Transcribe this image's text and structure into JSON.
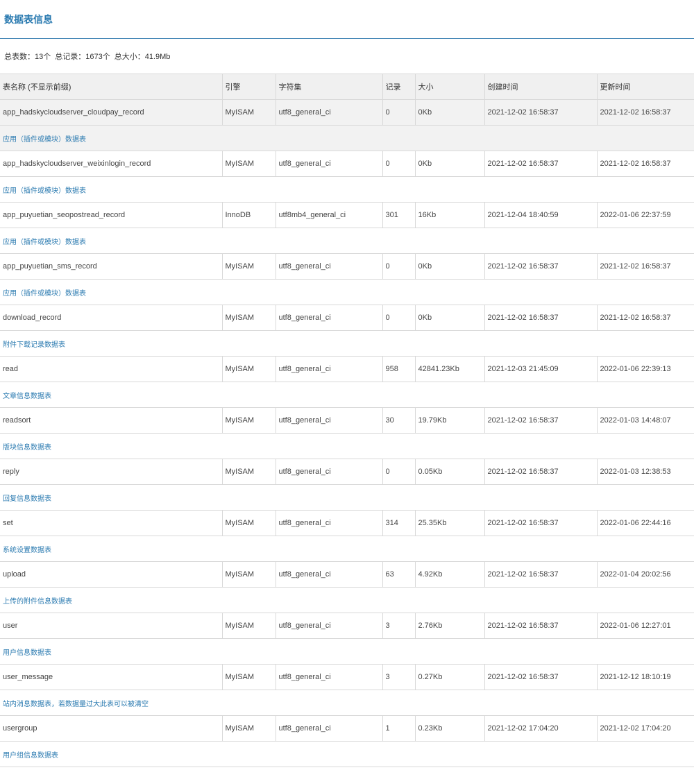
{
  "header": {
    "title": "数据表信息"
  },
  "summary": {
    "tables": "总表数：13个",
    "records": "总记录：1673个",
    "size": "总大小：41.9Mb"
  },
  "table": {
    "columns": [
      "表名称 (不显示前缀)",
      "引擎",
      "字符集",
      "记录",
      "大小",
      "创建时间",
      "更新时间"
    ],
    "rows": [
      {
        "name": "app_hadskycloudserver_cloudpay_record",
        "engine": "MyISAM",
        "charset": "utf8_general_ci",
        "records": "0",
        "size": "0Kb",
        "created": "2021-12-02 16:58:37",
        "updated": "2021-12-02 16:58:37",
        "desc": "应用（插件或模块）数据表"
      },
      {
        "name": "app_hadskycloudserver_weixinlogin_record",
        "engine": "MyISAM",
        "charset": "utf8_general_ci",
        "records": "0",
        "size": "0Kb",
        "created": "2021-12-02 16:58:37",
        "updated": "2021-12-02 16:58:37",
        "desc": "应用（插件或模块）数据表"
      },
      {
        "name": "app_puyuetian_seopostread_record",
        "engine": "InnoDB",
        "charset": "utf8mb4_general_ci",
        "records": "301",
        "size": "16Kb",
        "created": "2021-12-04 18:40:59",
        "updated": "2022-01-06 22:37:59",
        "desc": "应用（插件或模块）数据表"
      },
      {
        "name": "app_puyuetian_sms_record",
        "engine": "MyISAM",
        "charset": "utf8_general_ci",
        "records": "0",
        "size": "0Kb",
        "created": "2021-12-02 16:58:37",
        "updated": "2021-12-02 16:58:37",
        "desc": "应用（插件或模块）数据表"
      },
      {
        "name": "download_record",
        "engine": "MyISAM",
        "charset": "utf8_general_ci",
        "records": "0",
        "size": "0Kb",
        "created": "2021-12-02 16:58:37",
        "updated": "2021-12-02 16:58:37",
        "desc": "附件下载记录数据表"
      },
      {
        "name": "read",
        "engine": "MyISAM",
        "charset": "utf8_general_ci",
        "records": "958",
        "size": "42841.23Kb",
        "created": "2021-12-03 21:45:09",
        "updated": "2022-01-06 22:39:13",
        "desc": "文章信息数据表"
      },
      {
        "name": "readsort",
        "engine": "MyISAM",
        "charset": "utf8_general_ci",
        "records": "30",
        "size": "19.79Kb",
        "created": "2021-12-02 16:58:37",
        "updated": "2022-01-03 14:48:07",
        "desc": "版块信息数据表"
      },
      {
        "name": "reply",
        "engine": "MyISAM",
        "charset": "utf8_general_ci",
        "records": "0",
        "size": "0.05Kb",
        "created": "2021-12-02 16:58:37",
        "updated": "2022-01-03 12:38:53",
        "desc": "回复信息数据表"
      },
      {
        "name": "set",
        "engine": "MyISAM",
        "charset": "utf8_general_ci",
        "records": "314",
        "size": "25.35Kb",
        "created": "2021-12-02 16:58:37",
        "updated": "2022-01-06 22:44:16",
        "desc": "系统设置数据表"
      },
      {
        "name": "upload",
        "engine": "MyISAM",
        "charset": "utf8_general_ci",
        "records": "63",
        "size": "4.92Kb",
        "created": "2021-12-02 16:58:37",
        "updated": "2022-01-04 20:02:56",
        "desc": "上传的附件信息数据表"
      },
      {
        "name": "user",
        "engine": "MyISAM",
        "charset": "utf8_general_ci",
        "records": "3",
        "size": "2.76Kb",
        "created": "2021-12-02 16:58:37",
        "updated": "2022-01-06 12:27:01",
        "desc": "用户信息数据表"
      },
      {
        "name": "user_message",
        "engine": "MyISAM",
        "charset": "utf8_general_ci",
        "records": "3",
        "size": "0.27Kb",
        "created": "2021-12-02 16:58:37",
        "updated": "2021-12-12 18:10:19",
        "desc": "站内消息数据表，若数据量过大此表可以被清空"
      },
      {
        "name": "usergroup",
        "engine": "MyISAM",
        "charset": "utf8_general_ci",
        "records": "1",
        "size": "0.23Kb",
        "created": "2021-12-02 17:04:20",
        "updated": "2021-12-02 17:04:20",
        "desc": "用户组信息数据表"
      }
    ]
  },
  "colors": {
    "accent": "#2a7ab0",
    "header_bg": "#f0f0f0",
    "highlight_bg": "#f2f2f2",
    "border": "#d8d8d8"
  }
}
